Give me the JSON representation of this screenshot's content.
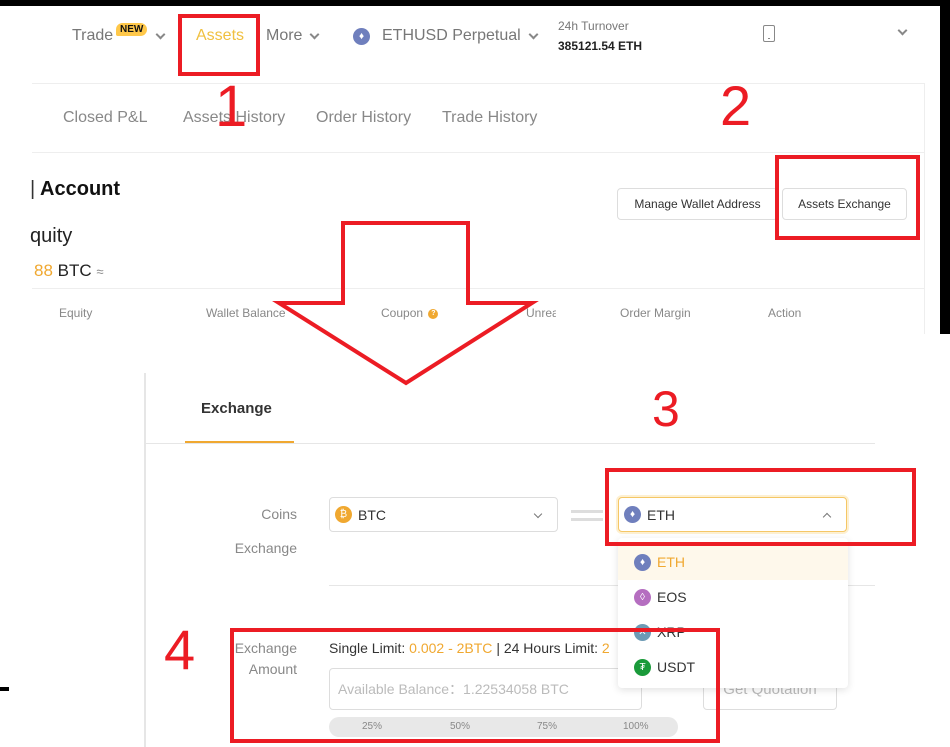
{
  "nav": {
    "trade": "Trade",
    "new_badge": "NEW",
    "assets": "Assets",
    "more": "More",
    "symbol": "ETHUSD Perpetual",
    "turnover_label": "24h Turnover",
    "turnover_value": "385121.54 ETH"
  },
  "sub_tabs": [
    "Closed P&L",
    "Assets History",
    "Order History",
    "Trade History"
  ],
  "account": {
    "title": "Account",
    "equity_title": "quity",
    "equity_value": "88",
    "equity_unit": "BTC",
    "approx": "≈"
  },
  "buttons": {
    "manage_wallet": "Manage Wallet Address",
    "assets_exchange": "Assets Exchange"
  },
  "table_headers": [
    "Equity",
    "Wallet Balance",
    "Coupon",
    "Unrea",
    "Order Margin",
    "Action"
  ],
  "exchange": {
    "tab": "Exchange",
    "coins_label": "Coins",
    "exchange_label": "Exchange",
    "from_coin": "BTC",
    "to_coin": "ETH",
    "dropdown_options": [
      "ETH",
      "EOS",
      "XRP",
      "USDT"
    ],
    "selected_option": "ETH",
    "amount_label_1": "Exchange",
    "amount_label_2": "Amount",
    "single_limit_label": "Single Limit:",
    "single_limit_value": "0.002 - 2BTC",
    "hours_limit_label": "| 24 Hours Limit:",
    "hours_limit_value": "2",
    "amount_placeholder": "Available Balance：1.22534058 BTC",
    "quote_button": "Get Quotation",
    "percent_options": [
      "25%",
      "50%",
      "75%",
      "100%"
    ]
  },
  "annotations": {
    "step1": "1",
    "step2": "2",
    "step3": "3",
    "step4": "4",
    "color": "#ec1c24"
  },
  "colors": {
    "accent": "#f0a830",
    "eth": "#6f7fbd",
    "eos": "#b56ec0",
    "xrp": "#6d9bb5",
    "usdt": "#1a9a3a"
  }
}
